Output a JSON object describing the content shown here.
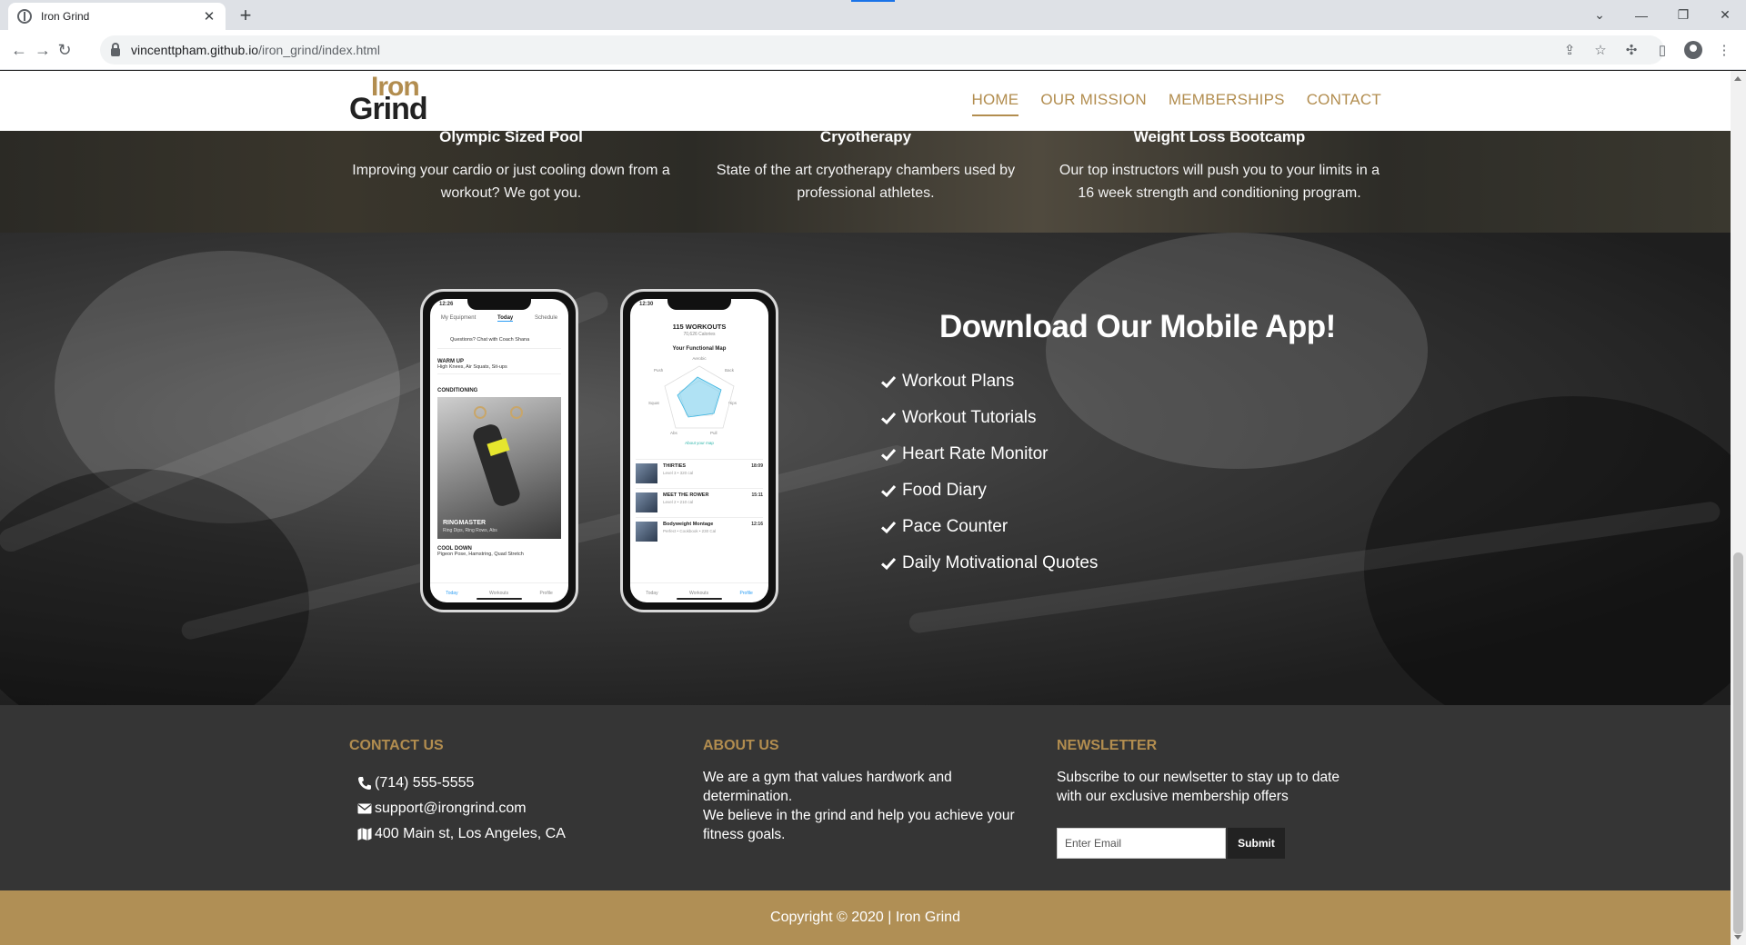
{
  "browser": {
    "tab_title": "Iron Grind",
    "url_host": "vincenttpham.github.io",
    "url_path": "/iron_grind/index.html"
  },
  "header": {
    "logo_top": "Iron",
    "logo_bottom": "Grind",
    "nav": [
      {
        "label": "HOME",
        "active": true
      },
      {
        "label": "OUR MISSION"
      },
      {
        "label": "MEMBERSHIPS"
      },
      {
        "label": "CONTACT"
      }
    ]
  },
  "amenities": [
    {
      "title": "Olympic Sized Pool",
      "desc": "Improving your cardio or just cooling down from a workout? We got you."
    },
    {
      "title": "Cryotherapy",
      "desc": "State of the art cryotherapy chambers used by professional athletes."
    },
    {
      "title": "Weight Loss Bootcamp",
      "desc": "Our top instructors will push you to your limits in a 16 week strength and conditioning program."
    }
  ],
  "app": {
    "title": "Download Our Mobile App!",
    "features": [
      "Workout Plans",
      "Workout Tutorials",
      "Heart Rate Monitor",
      "Food Diary",
      "Pace Counter",
      "Daily Motivational Quotes"
    ],
    "phone1": {
      "time": "12:26",
      "tabs": [
        "My Equipment",
        "Today",
        "Schedule"
      ],
      "coach": "Questions? Chat with Coach Shana",
      "warmup_title": "WARM UP",
      "warmup_sub": "High Knees, Air Squats, Sit-ups",
      "conditioning": "CONDITIONING",
      "photo_title": "RINGMASTER",
      "photo_sub": "Ring Dips, Ring Rows, Abs",
      "cooldown_title": "COOL DOWN",
      "cooldown_sub": "Pigeon Pose, Hamstring, Quad Stretch",
      "bottom": [
        "Today",
        "Workouts",
        "Profile"
      ]
    },
    "phone2": {
      "time": "12:30",
      "workouts": "115 WORKOUTS",
      "calories": "70,626 Calories",
      "map_title": "Your Functional Map",
      "radar_labels": [
        "Aerobic",
        "Push",
        "Back",
        "Squat",
        "Hips",
        "Abs",
        "Pull"
      ],
      "link": "About your map",
      "items": [
        {
          "title": "THIRTIES",
          "sub": "Level 3 • 320 cal",
          "time": "18:09"
        },
        {
          "title": "MEET THE ROWER",
          "sub": "Level 2 • 210 cal",
          "time": "15:11"
        },
        {
          "title": "Bodyweight Montage",
          "sub": "Perfect • Cookbook • 230 Cal",
          "time": "12:16"
        }
      ],
      "bottom": [
        "Today",
        "Workouts",
        "Profile"
      ]
    }
  },
  "footer": {
    "contact_heading": "CONTACT US",
    "phone": "(714) 555-5555",
    "email": "support@irongrind.com",
    "address": "400 Main st, Los Angeles, CA",
    "about_heading": "ABOUT US",
    "about_p1": "We are a gym that values hardwork and determination.",
    "about_p2": "We believe in the grind and help you achieve your fitness goals.",
    "newsletter_heading": "NEWSLETTER",
    "newsletter_text": "Subscribe to our newlsetter to stay up to date with our exclusive membership offers",
    "email_placeholder": "Enter Email",
    "submit_label": "Submit",
    "copyright": "Copyright © 2020 | Iron Grind"
  },
  "colors": {
    "accent": "#b28d4f",
    "footer_bg": "#353535",
    "copyright_bg": "#b08f55"
  }
}
